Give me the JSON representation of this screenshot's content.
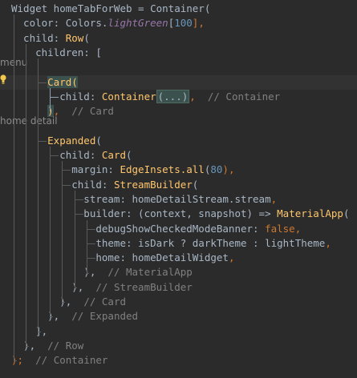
{
  "editor": {
    "lines": [
      [
        {
          "t": "Widget homeTabForWeb = ",
          "c": "plain"
        },
        {
          "t": "Container",
          "c": "plain"
        },
        {
          "t": "(",
          "c": "plain"
        }
      ],
      [
        {
          "t": "  color: Colors.",
          "c": "plain"
        },
        {
          "t": "lightGreen",
          "c": "italic"
        },
        {
          "t": "[",
          "c": "plain"
        },
        {
          "t": "100",
          "c": "num"
        },
        {
          "t": "],",
          "c": "kw"
        }
      ],
      [
        {
          "t": "  child: ",
          "c": "plain"
        },
        {
          "t": "Row",
          "c": "fn"
        },
        {
          "t": "(",
          "c": "plain"
        }
      ],
      [
        {
          "t": "    children: [",
          "c": "plain"
        }
      ],
      [
        {
          "t": "",
          "c": "plain"
        }
      ],
      [
        {
          "t": "      ",
          "c": "plain"
        },
        {
          "t": "Card(",
          "c": "bracket"
        }
      ],
      [
        {
          "t": "        child: ",
          "c": "plain"
        },
        {
          "t": "Container",
          "c": "fn"
        },
        {
          "t": "(...)",
          "c": "folded"
        },
        {
          "t": ",",
          "c": "kw"
        },
        {
          "t": "  // Container",
          "c": "comment"
        }
      ],
      [
        {
          "t": "      ",
          "c": "plain"
        },
        {
          "t": ")",
          "c": "bracket"
        },
        {
          "t": ",",
          "c": "kw"
        },
        {
          "t": "  // Card",
          "c": "comment"
        }
      ],
      [
        {
          "t": "",
          "c": "plain"
        }
      ],
      [
        {
          "t": "      ",
          "c": "plain"
        },
        {
          "t": "Expanded",
          "c": "fn"
        },
        {
          "t": "(",
          "c": "plain"
        }
      ],
      [
        {
          "t": "        child: ",
          "c": "plain"
        },
        {
          "t": "Card",
          "c": "fn"
        },
        {
          "t": "(",
          "c": "plain"
        }
      ],
      [
        {
          "t": "          margin: ",
          "c": "plain"
        },
        {
          "t": "EdgeInsets.all",
          "c": "fn"
        },
        {
          "t": "(",
          "c": "plain"
        },
        {
          "t": "80",
          "c": "num"
        },
        {
          "t": "),",
          "c": "kw"
        }
      ],
      [
        {
          "t": "          child: ",
          "c": "plain"
        },
        {
          "t": "StreamBuilder",
          "c": "fn"
        },
        {
          "t": "(",
          "c": "plain"
        }
      ],
      [
        {
          "t": "            stream: homeDetailStream.stream",
          "c": "plain"
        },
        {
          "t": ",",
          "c": "kw"
        }
      ],
      [
        {
          "t": "            builder: (context, snapshot) => ",
          "c": "plain"
        },
        {
          "t": "MaterialApp",
          "c": "fn"
        },
        {
          "t": "(",
          "c": "plain"
        }
      ],
      [
        {
          "t": "              debugShowCheckedModeBanner: ",
          "c": "plain"
        },
        {
          "t": "false",
          "c": "kw"
        },
        {
          "t": ",",
          "c": "kw"
        }
      ],
      [
        {
          "t": "              theme: isDark ? darkTheme : lightTheme",
          "c": "plain"
        },
        {
          "t": ",",
          "c": "kw"
        }
      ],
      [
        {
          "t": "              home: homeDetailWidget",
          "c": "plain"
        },
        {
          "t": ",",
          "c": "kw"
        }
      ],
      [
        {
          "t": "            ),",
          "c": "plain"
        },
        {
          "t": "  // MaterialApp",
          "c": "comment"
        }
      ],
      [
        {
          "t": "          ),",
          "c": "plain"
        },
        {
          "t": "  // StreamBuilder",
          "c": "comment"
        }
      ],
      [
        {
          "t": "        ),",
          "c": "plain"
        },
        {
          "t": "  // Card",
          "c": "comment"
        }
      ],
      [
        {
          "t": "      ),",
          "c": "plain"
        },
        {
          "t": "  // Expanded",
          "c": "comment"
        }
      ],
      [
        {
          "t": "    ],",
          "c": "plain"
        }
      ],
      [
        {
          "t": "  ),",
          "c": "plain"
        },
        {
          "t": "  // Row",
          "c": "comment"
        }
      ],
      [
        {
          "t": ");",
          "c": "kw"
        },
        {
          "t": "  // Container",
          "c": "comment"
        }
      ]
    ],
    "hints": [
      {
        "text": "menu",
        "line": 4
      },
      {
        "text": "home detail",
        "line": 8
      }
    ],
    "current_line_index": 5
  },
  "colors": {
    "background": "#2b2b2b",
    "current_line": "#323232",
    "keyword": "#cc7832",
    "function": "#ffc66d",
    "number": "#6897bb",
    "field_italic": "#9876aa",
    "comment": "#808080",
    "text": "#a9b7c6"
  },
  "icons": {
    "gutter": "lightbulb-icon"
  }
}
